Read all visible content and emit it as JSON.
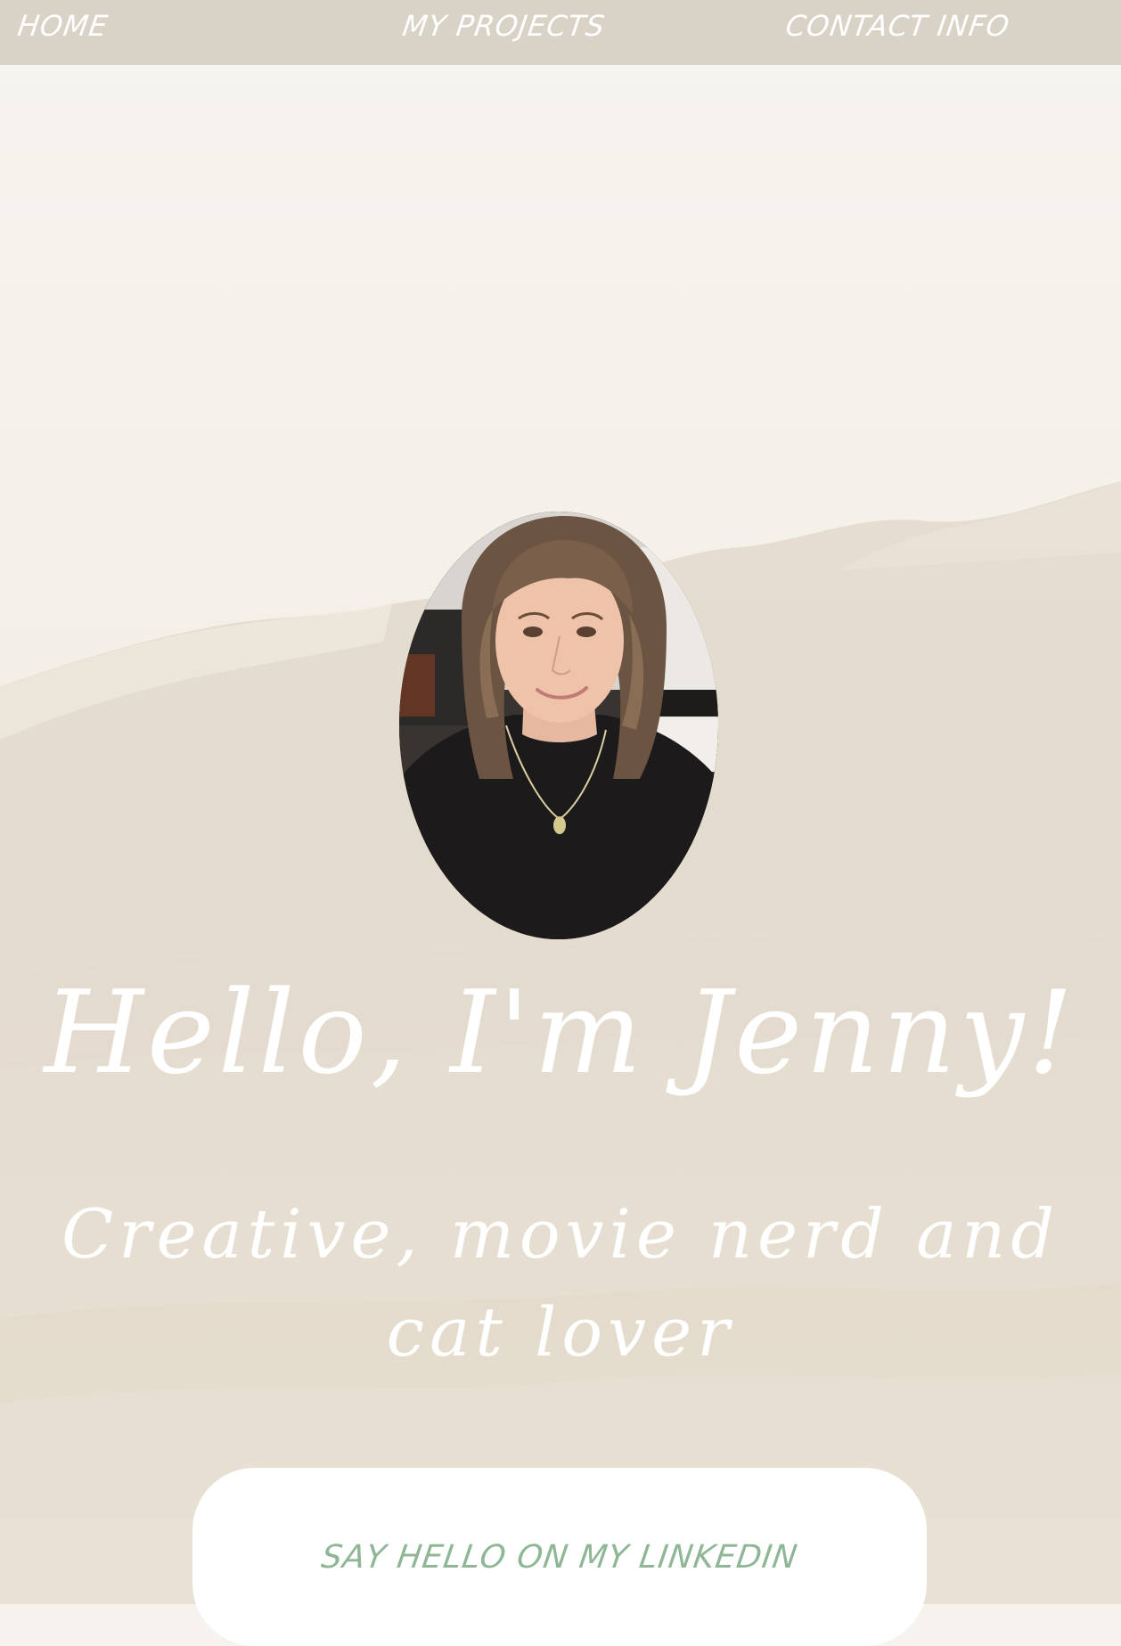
{
  "nav": {
    "home_label": "HOME",
    "projects_label": "MY PROJECTS",
    "contact_label": "CONTACT INFO"
  },
  "hero": {
    "title": "Hello, I'm Jenny!",
    "subtitle": "Creative, movie nerd and cat lover"
  },
  "linkedin": {
    "label": "SAY HELLO ON MY LINKEDIN"
  },
  "colors": {
    "nav_bg": "#d9d2c6",
    "background": "#ece6dc",
    "heading_text": "#ffffff",
    "link_text": "#8fb796",
    "card_bg": "#ffffff"
  }
}
